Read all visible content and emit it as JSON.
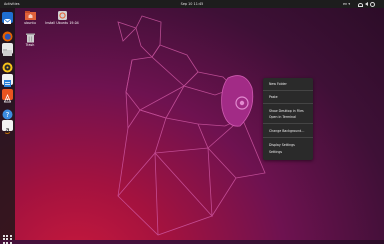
{
  "topbar": {
    "activities": "Activities",
    "clock": "Sep 10  11:45",
    "language": "en ▾"
  },
  "tray_icons": [
    "network-icon",
    "volume-icon",
    "power-icon"
  ],
  "dock": {
    "apps": [
      {
        "name": "thunderbird-icon",
        "color": "#1f6fd1"
      },
      {
        "name": "firefox-icon",
        "color": "#e66000"
      },
      {
        "name": "files-icon",
        "color": "#e9e9e9"
      },
      {
        "name": "rhythmbox-icon",
        "color": "#f6c21a"
      },
      {
        "name": "libreoffice-writer-icon",
        "color": "#2a7fd8"
      },
      {
        "name": "ubuntu-software-icon",
        "color": "#e95420"
      },
      {
        "name": "help-icon",
        "color": "#3c8ce0"
      },
      {
        "name": "amazon-icon",
        "color": "#f2f2f2"
      },
      {
        "name": "terminal-icon",
        "color": "#3a3a3a"
      }
    ],
    "show_apps": "grid-icon"
  },
  "desktop": {
    "items": [
      {
        "label": "ubuntu",
        "icon": "home-folder-icon"
      },
      {
        "label": "Install Ubuntu 19.04",
        "icon": "installer-icon"
      },
      {
        "label": "Trash",
        "icon": "trash-icon"
      }
    ]
  },
  "context_menu": {
    "items": [
      "New Folder",
      "Paste",
      "Show Desktop in Files",
      "Open in Terminal",
      "Change Background…",
      "Display Settings",
      "Settings"
    ]
  },
  "colors": {
    "accent": "#e95420",
    "menu_bg": "#2a2a2a",
    "topbar_bg": "#1d1d1d"
  }
}
